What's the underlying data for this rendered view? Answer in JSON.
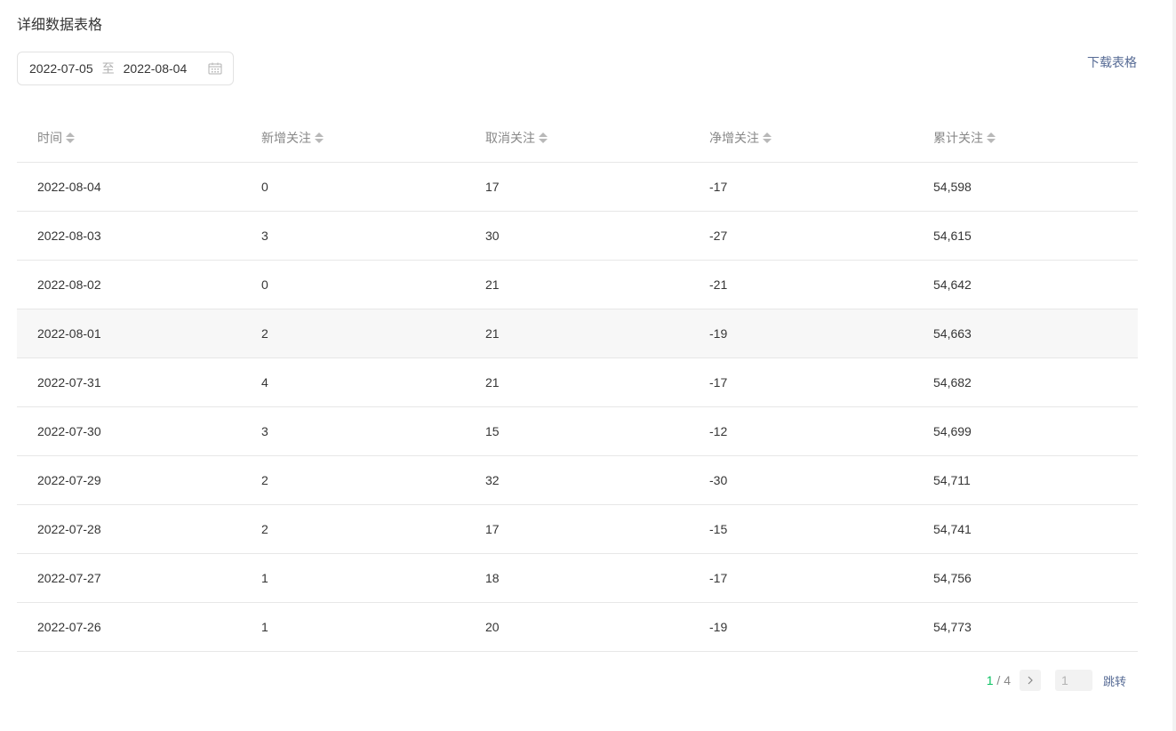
{
  "section": {
    "title": "详细数据表格"
  },
  "date_range": {
    "start": "2022-07-05",
    "separator": "至",
    "end": "2022-08-04"
  },
  "actions": {
    "download": "下载表格"
  },
  "table": {
    "columns": [
      "时间",
      "新增关注",
      "取消关注",
      "净增关注",
      "累计关注"
    ],
    "rows": [
      [
        "2022-08-04",
        "0",
        "17",
        "-17",
        "54,598"
      ],
      [
        "2022-08-03",
        "3",
        "30",
        "-27",
        "54,615"
      ],
      [
        "2022-08-02",
        "0",
        "21",
        "-21",
        "54,642"
      ],
      [
        "2022-08-01",
        "2",
        "21",
        "-19",
        "54,663"
      ],
      [
        "2022-07-31",
        "4",
        "21",
        "-17",
        "54,682"
      ],
      [
        "2022-07-30",
        "3",
        "15",
        "-12",
        "54,699"
      ],
      [
        "2022-07-29",
        "2",
        "32",
        "-30",
        "54,711"
      ],
      [
        "2022-07-28",
        "2",
        "17",
        "-15",
        "54,741"
      ],
      [
        "2022-07-27",
        "1",
        "18",
        "-17",
        "54,756"
      ],
      [
        "2022-07-26",
        "1",
        "20",
        "-19",
        "54,773"
      ]
    ],
    "highlighted_row": 3
  },
  "pagination": {
    "current": "1",
    "separator": " / ",
    "total": "4",
    "page_input_placeholder": "1",
    "jump_label": "跳转"
  },
  "icons": {
    "calendar": "calendar-icon",
    "sort": "sort-icon",
    "next": "chevron-right-icon"
  },
  "colors": {
    "link": "#576b95",
    "current_page": "#07c160",
    "text": "#353535",
    "muted": "#888888"
  }
}
